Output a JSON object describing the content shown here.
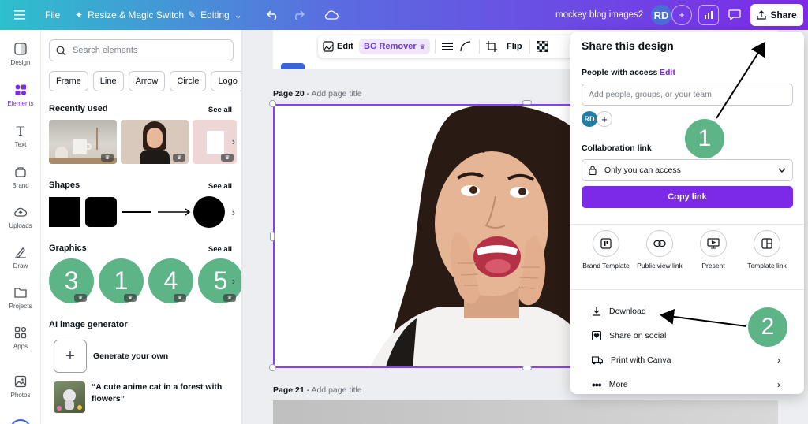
{
  "topbar": {
    "file": "File",
    "resize": "Resize & Magic Switch",
    "editing": "Editing",
    "doc_name": "mockey blog images2",
    "avatar": "RD",
    "share": "Share"
  },
  "rail": {
    "items": [
      {
        "label": "Design",
        "icon": "design-icon"
      },
      {
        "label": "Elements",
        "icon": "elements-icon"
      },
      {
        "label": "Text",
        "icon": "text-icon"
      },
      {
        "label": "Brand",
        "icon": "brand-icon"
      },
      {
        "label": "Uploads",
        "icon": "uploads-icon"
      },
      {
        "label": "Draw",
        "icon": "draw-icon"
      },
      {
        "label": "Projects",
        "icon": "projects-icon"
      },
      {
        "label": "Apps",
        "icon": "apps-icon"
      },
      {
        "label": "Photos",
        "icon": "photos-icon"
      }
    ]
  },
  "panel": {
    "search_placeholder": "Search elements",
    "chips": [
      "Frame",
      "Line",
      "Arrow",
      "Circle",
      "Logo"
    ],
    "recent_title": "Recently used",
    "shapes_title": "Shapes",
    "graphics_title": "Graphics",
    "see_all": "See all",
    "graphics_numbers": [
      "3",
      "1",
      "4",
      "5"
    ],
    "ai_title": "AI image generator",
    "ai_generate": "Generate your own",
    "ai_prompt": "“A cute anime cat in a forest with flowers”"
  },
  "toolbar": {
    "edit": "Edit",
    "bg_remover": "BG Remover",
    "flip": "Flip"
  },
  "canvas": {
    "page20_label": "Page 20",
    "page21_label": "Page 21",
    "page_title_placeholder": "Add page title",
    "separator": " - "
  },
  "share": {
    "title": "Share this design",
    "people_with_access": "People with access",
    "edit": "Edit",
    "add_people_placeholder": "Add people, groups, or your team",
    "avatar": "RD",
    "collab_link": "Collaboration link",
    "access_value": "Only you can access",
    "copy_link": "Copy link",
    "options": [
      {
        "label": "Brand Template",
        "icon": "brand-template-icon"
      },
      {
        "label": "Public view link",
        "icon": "public-link-icon"
      },
      {
        "label": "Present",
        "icon": "present-icon"
      },
      {
        "label": "Template link",
        "icon": "template-link-icon"
      }
    ],
    "download": "Download",
    "share_social": "Share on social",
    "print": "Print with Canva",
    "more": "More"
  },
  "annotations": {
    "badge1": "1",
    "badge2": "2"
  },
  "colors": {
    "accent": "#7d2ae8",
    "badge": "#5cb487"
  }
}
